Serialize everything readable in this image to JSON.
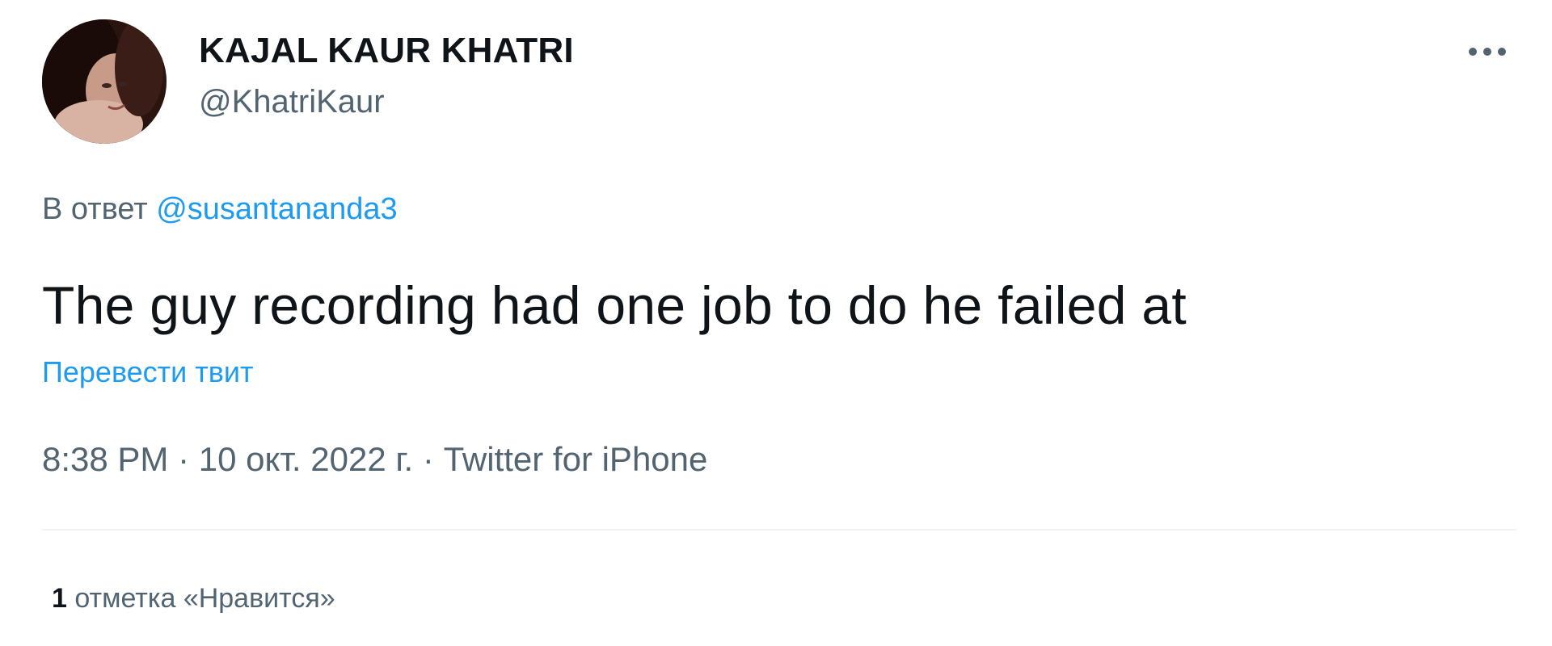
{
  "author": {
    "display_name": "KAJAL KAUR KHATRI",
    "handle": "@KhatriKaur",
    "avatar_icon": "profile-photo"
  },
  "reply": {
    "prefix": "В ответ",
    "mention": "@susantananda3"
  },
  "tweet": {
    "text": "The guy recording had one job to do he failed at",
    "translate_label": "Перевести твит"
  },
  "meta": {
    "time": "8:38 PM",
    "separator1": " · ",
    "date": "10 окт. 2022 г.",
    "separator2": " · ",
    "source": "Twitter for iPhone"
  },
  "engagement": {
    "likes_count": "1",
    "likes_label": "отметка «Нравится»"
  },
  "icons": {
    "more": "more-horizontal-icon"
  },
  "colors": {
    "link": "#1d9bf0",
    "secondary_text": "#536471",
    "primary_text": "#0f1419",
    "divider": "#eff3f4"
  }
}
